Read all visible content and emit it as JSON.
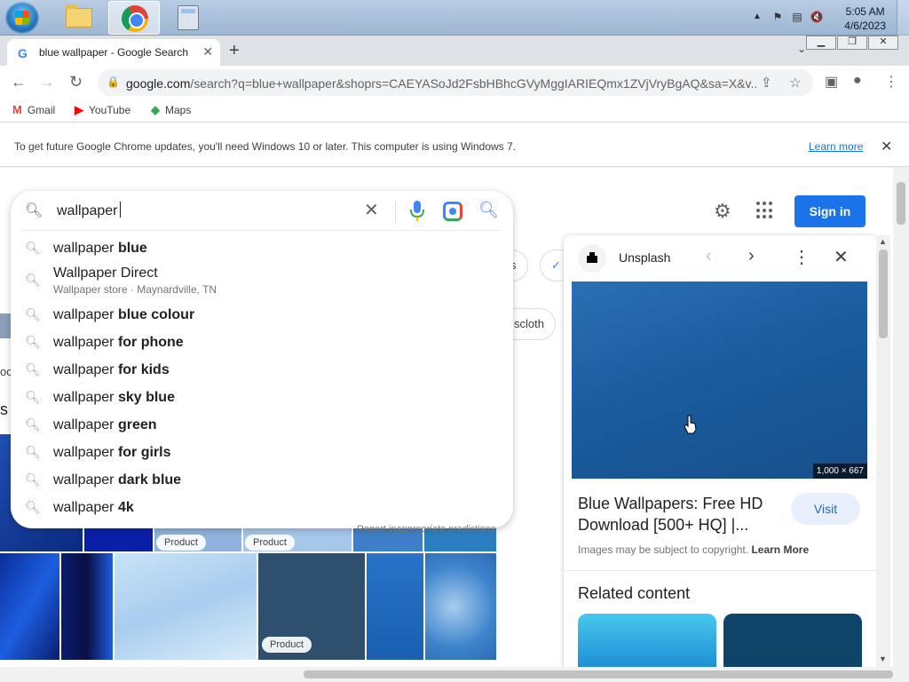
{
  "taskbar": {
    "clock_time": "5:05 AM",
    "clock_date": "4/6/2023",
    "apps": [
      "windows-explorer",
      "google-chrome",
      "calculator"
    ]
  },
  "browser": {
    "tab": {
      "title": "blue wallpaper - Google Search",
      "favicon": "G"
    },
    "new_tab_label": "+",
    "url_host": "google.com",
    "url_rest": "/search?q=blue+wallpaper&shoprs=CAEYASoJd2FsbHBhcGVyMggIARIEQmx1ZVjVryBgAQ&sa=X&v...",
    "bookmarks": [
      {
        "label": "Gmail",
        "icon": "gmail-icon",
        "color": "#ea4335"
      },
      {
        "label": "YouTube",
        "icon": "youtube-icon",
        "color": "#ff0000"
      },
      {
        "label": "Maps",
        "icon": "maps-icon",
        "color": "#34a853"
      }
    ],
    "infobar": {
      "message": "To get future Google Chrome updates, you'll need Windows 10 or later. This computer is using Windows 7.",
      "link": "Learn more"
    }
  },
  "page": {
    "sign_in": "Sign in",
    "chips": [
      {
        "label": "s"
      },
      {
        "label": "scloth"
      }
    ],
    "side_letters": {
      "a": "oc",
      "b": "s"
    },
    "product_badges": [
      "Product",
      "Product",
      "Product"
    ]
  },
  "search": {
    "query": "wallpaper",
    "suggestions": [
      {
        "prefix": "wallpaper ",
        "bold": "blue"
      },
      {
        "prefix": "Wallpaper Direct",
        "bold": "",
        "sub": "Wallpaper store · Maynardville, TN"
      },
      {
        "prefix": "wallpaper ",
        "bold": "blue colour"
      },
      {
        "prefix": "wallpaper ",
        "bold": "for phone"
      },
      {
        "prefix": "wallpaper ",
        "bold": "for kids"
      },
      {
        "prefix": "wallpaper ",
        "bold": "sky blue"
      },
      {
        "prefix": "wallpaper ",
        "bold": "green"
      },
      {
        "prefix": "wallpaper ",
        "bold": "for girls"
      },
      {
        "prefix": "wallpaper ",
        "bold": "dark blue"
      },
      {
        "prefix": "wallpaper ",
        "bold": "4k"
      }
    ],
    "report": "Report inappropriate predictions"
  },
  "panel": {
    "source": "Unsplash",
    "dimensions": "1,000 × 667",
    "title": "Blue Wallpapers: Free HD Download [500+ HQ] |...",
    "visit": "Visit",
    "copyright_text": "Images may be subject to copyright.",
    "copyright_link": "Learn More",
    "related": "Related content"
  },
  "colors": {
    "accent": "#1a73e8",
    "preview_blue": "#1f5f9f"
  }
}
